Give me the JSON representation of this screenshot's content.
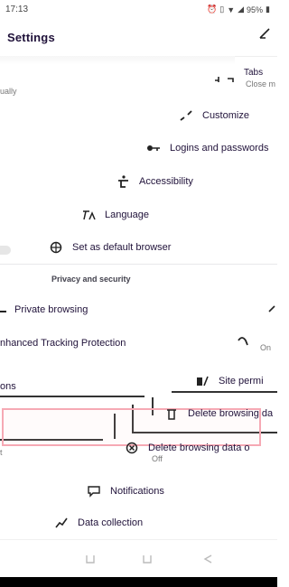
{
  "statusbar": {
    "time": "17:13",
    "battery": "95%"
  },
  "header": {
    "title": "Settings"
  },
  "items": {
    "close_fragment_top": "Tabs",
    "close_fragment_sub": "Close m",
    "left_fragment_sub": "ually",
    "customize": "Customize",
    "logins": "Logins and passwords",
    "accessibility": "Accessibility",
    "language": "Language",
    "default_browser": "Set as default browser",
    "private_browsing": "Private browsing",
    "etp": "nhanced Tracking Protection",
    "etp_state": "On",
    "ons_fragment": "ons",
    "site_permissions": "Site permi",
    "delete_browsing_top": "Delete browsing da",
    "delete_browsing_quit": "Delete browsing data o",
    "delete_browsing_quit_state": "Off",
    "notifications": "Notifications",
    "data_collection": "Data collection"
  },
  "sections": {
    "privacy": "Privacy and security"
  },
  "icons": {
    "back": "arrow-left-icon",
    "customize": "brush-icon",
    "logins": "key-icon",
    "accessibility": "accessibility-icon",
    "language": "language-icon",
    "default_browser": "globe-check-icon",
    "etp": "shield-icon",
    "site_permissions": "permissions-icon",
    "delete": "trash-icon",
    "delete_quit": "close-circle-icon",
    "notifications": "chat-bubble-icon",
    "data_collection": "chart-line-icon"
  },
  "colors": {
    "highlight": "#f6a9b4",
    "text": "#20123a",
    "secondary": "#777777"
  }
}
